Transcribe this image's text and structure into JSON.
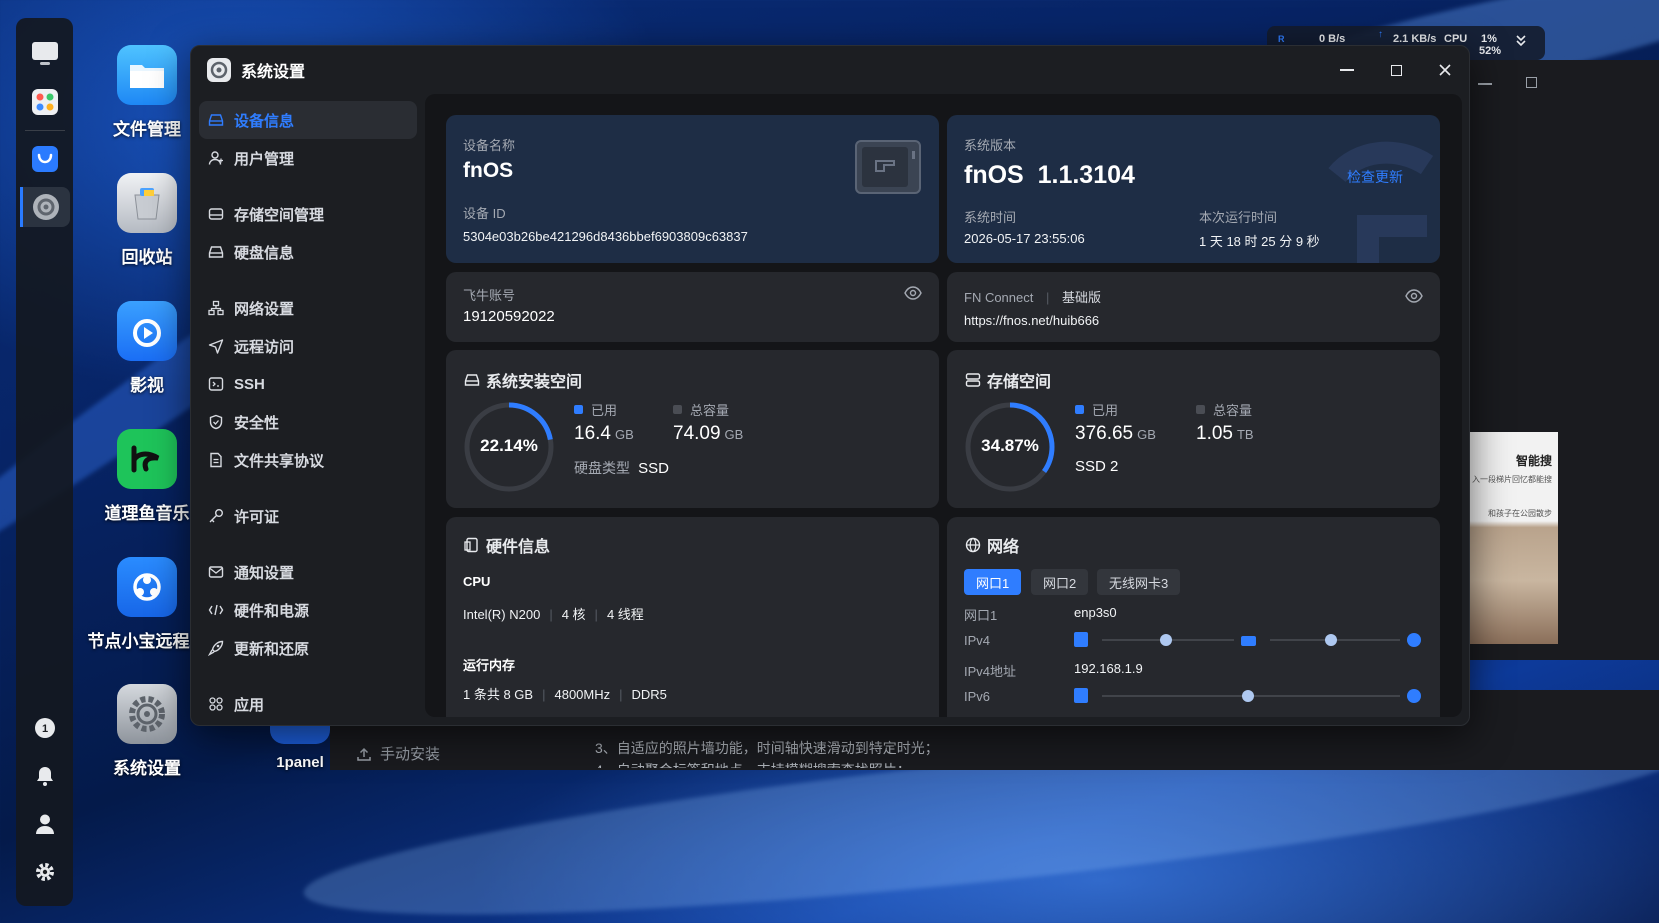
{
  "desktop": {
    "icons": [
      {
        "label": "文件管理"
      },
      {
        "label": "回收站"
      },
      {
        "label": "影视"
      },
      {
        "label": "道理鱼音乐"
      },
      {
        "label": "节点小宝远程助"
      },
      {
        "label": "系统设置"
      },
      {
        "label": "1panel"
      }
    ],
    "bg_text": {
      "install": "手动安装",
      "line3": "3、自适应的照片墙功能，时间轴快速滑动到特定时光；",
      "line4": "4、自动聚合标签和地点，支持模糊搜索查找照片；",
      "thumb_title": "智能搜",
      "thumb_line1": "入一段梯片回忆都能搜",
      "thumb_line2": "和孩子在公园散步"
    }
  },
  "statusbar": {
    "down_icon": "R",
    "down": "0  B/s",
    "up": "2.1 KB/s",
    "cpu_label": "CPU",
    "cpu": "1%",
    "mem": "52%"
  },
  "window": {
    "title": "系统设置"
  },
  "sidebar": {
    "items": [
      {
        "label": "设备信息"
      },
      {
        "label": "用户管理"
      },
      {
        "label": "存储空间管理"
      },
      {
        "label": "硬盘信息"
      },
      {
        "label": "网络设置"
      },
      {
        "label": "远程访问"
      },
      {
        "label": "SSH"
      },
      {
        "label": "安全性"
      },
      {
        "label": "文件共享协议"
      },
      {
        "label": "许可证"
      },
      {
        "label": "通知设置"
      },
      {
        "label": "硬件和电源"
      },
      {
        "label": "更新和还原"
      },
      {
        "label": "应用"
      }
    ]
  },
  "device": {
    "name_label": "设备名称",
    "name": "fnOS",
    "id_label": "设备 ID",
    "id": "5304e03b26be421296d8436bbef6903809c63837"
  },
  "version": {
    "label": "系统版本",
    "value": "fnOS  1.1.3104",
    "check_update": "检查更新",
    "time_label": "系统时间",
    "time": "2026-05-17 23:55:06",
    "uptime_label": "本次运行时间",
    "uptime": "1 天 18 时 25 分 9 秒"
  },
  "account": {
    "label": "飞牛账号",
    "value": "19120592022"
  },
  "fnconnect": {
    "label": "FN Connect",
    "edition": "基础版",
    "url": "https://fnos.net/huib666"
  },
  "install_space": {
    "title": "系统安装空间",
    "percent": "22.14%",
    "fraction": 0.2214,
    "used_label": "已用",
    "used": "16.4",
    "used_unit": "GB",
    "total_label": "总容量",
    "total": "74.09",
    "total_unit": "GB",
    "disk_type_label": "硬盘类型",
    "disk_type": "SSD"
  },
  "storage": {
    "title": "存储空间",
    "percent": "34.87%",
    "fraction": 0.3487,
    "used_label": "已用",
    "used": "376.65",
    "used_unit": "GB",
    "total_label": "总容量",
    "total": "1.05",
    "total_unit": "TB",
    "ssd": "SSD 2"
  },
  "hardware": {
    "title": "硬件信息",
    "cpu_label": "CPU",
    "cpu_model": "Intel(R) N200",
    "cores": "4 核",
    "threads": "4 线程",
    "mem_label": "运行内存",
    "mem_slots": "1 条共 8 GB",
    "mem_freq": "4800MHz",
    "mem_type": "DDR5"
  },
  "network": {
    "title": "网络",
    "tabs": [
      "网口1",
      "网口2",
      "无线网卡3"
    ],
    "port_label": "网口1",
    "port": "enp3s0",
    "ipv4_label": "IPv4",
    "ipv4_addr_label": "IPv4地址",
    "ipv4_addr": "192.168.1.9",
    "ipv6_label": "IPv6"
  },
  "colors": {
    "accent": "#2f7dff",
    "ring_track": "#3a3d44"
  }
}
